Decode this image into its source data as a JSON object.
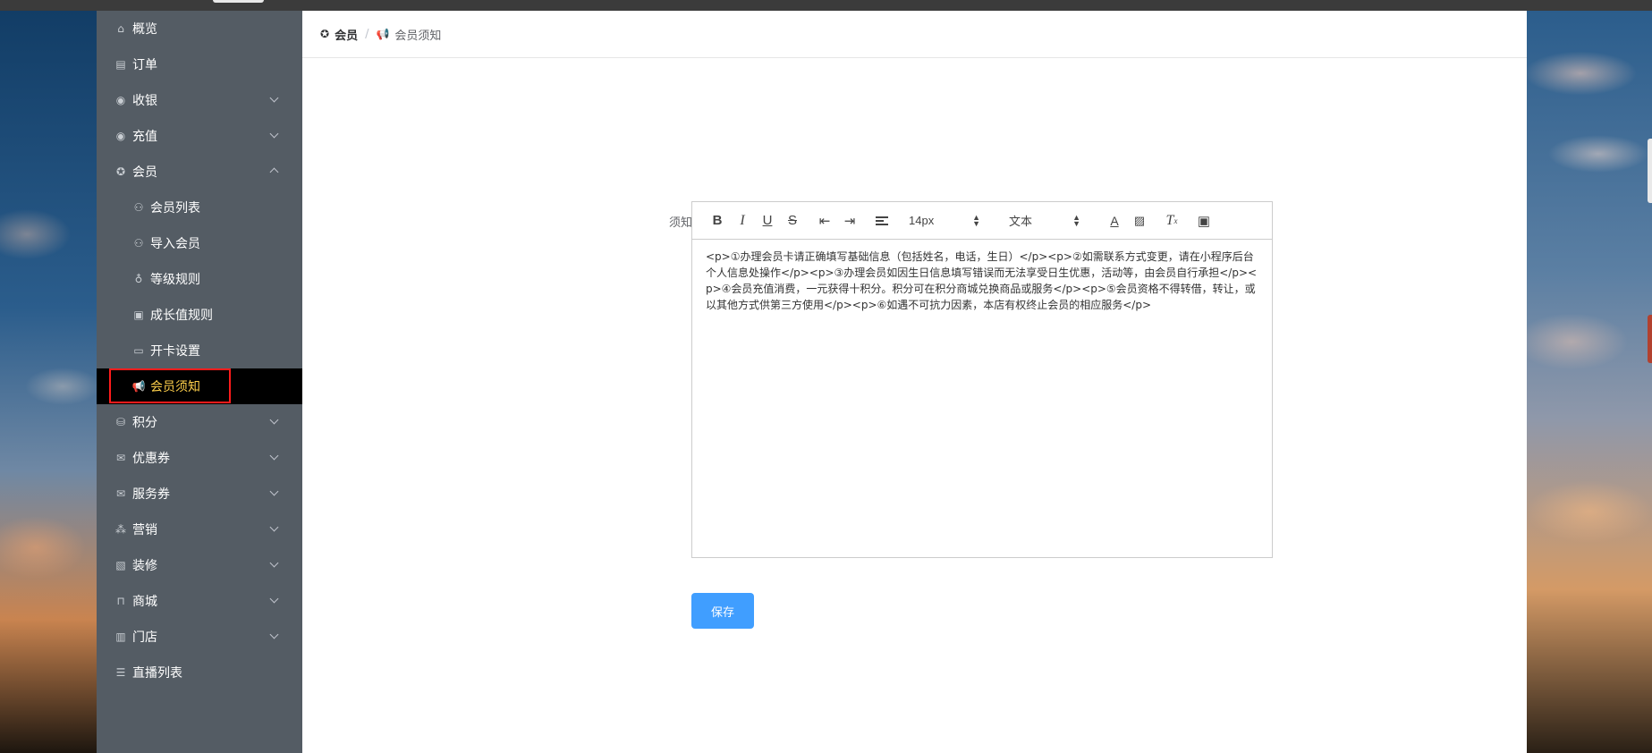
{
  "sidebar": {
    "items": [
      {
        "label": "概览",
        "icon": "home-icon",
        "expandable": false
      },
      {
        "label": "订单",
        "icon": "document-icon",
        "expandable": false
      },
      {
        "label": "收银",
        "icon": "yen-circle-icon",
        "expandable": true
      },
      {
        "label": "充值",
        "icon": "yen-circle-icon",
        "expandable": true
      },
      {
        "label": "会员",
        "icon": "member-badge-icon",
        "expandable": true,
        "expanded": true
      },
      {
        "label": "会员列表",
        "icon": "users-icon",
        "sub": true
      },
      {
        "label": "导入会员",
        "icon": "users-icon",
        "sub": true
      },
      {
        "label": "等级规则",
        "icon": "medal-icon",
        "sub": true
      },
      {
        "label": "成长值规则",
        "icon": "id-card-icon",
        "sub": true
      },
      {
        "label": "开卡设置",
        "icon": "credit-card-icon",
        "sub": true
      },
      {
        "label": "会员须知",
        "icon": "megaphone-icon",
        "sub": true,
        "active": true
      },
      {
        "label": "积分",
        "icon": "coins-icon",
        "expandable": true
      },
      {
        "label": "优惠券",
        "icon": "ticket-icon",
        "expandable": true
      },
      {
        "label": "服务券",
        "icon": "ticket-icon",
        "expandable": true
      },
      {
        "label": "营销",
        "icon": "network-icon",
        "expandable": true
      },
      {
        "label": "装修",
        "icon": "brush-icon",
        "expandable": true
      },
      {
        "label": "商城",
        "icon": "shop-bag-icon",
        "expandable": true
      },
      {
        "label": "门店",
        "icon": "store-icon",
        "expandable": true
      },
      {
        "label": "直播列表",
        "icon": "list-icon",
        "expandable": false
      }
    ],
    "active_color": "#ffd04b",
    "background": "#545c64"
  },
  "breadcrumb": {
    "parent": "会员",
    "current": "会员须知",
    "separator": "/"
  },
  "form": {
    "label": "须知详情",
    "editor": {
      "toolbar": {
        "font_size": "14px",
        "block_type": "文本"
      },
      "content": "<p>①办理会员卡请正确填写基础信息（包括姓名，电话，生日）</p><p>②如需联系方式变更，请在小程序后台个人信息处操作</p><p>③办理会员如因生日信息填写错误而无法享受日生优惠，活动等，由会员自行承担</p><p>④会员充值消费，一元获得十积分。积分可在积分商城兑换商品或服务</p><p>⑤会员资格不得转借，转让，或以其他方式供第三方使用</p><p>⑥如遇不可抗力因素，本店有权终止会员的相应服务</p>"
    },
    "save_label": "保存",
    "save_color": "#409eff"
  }
}
